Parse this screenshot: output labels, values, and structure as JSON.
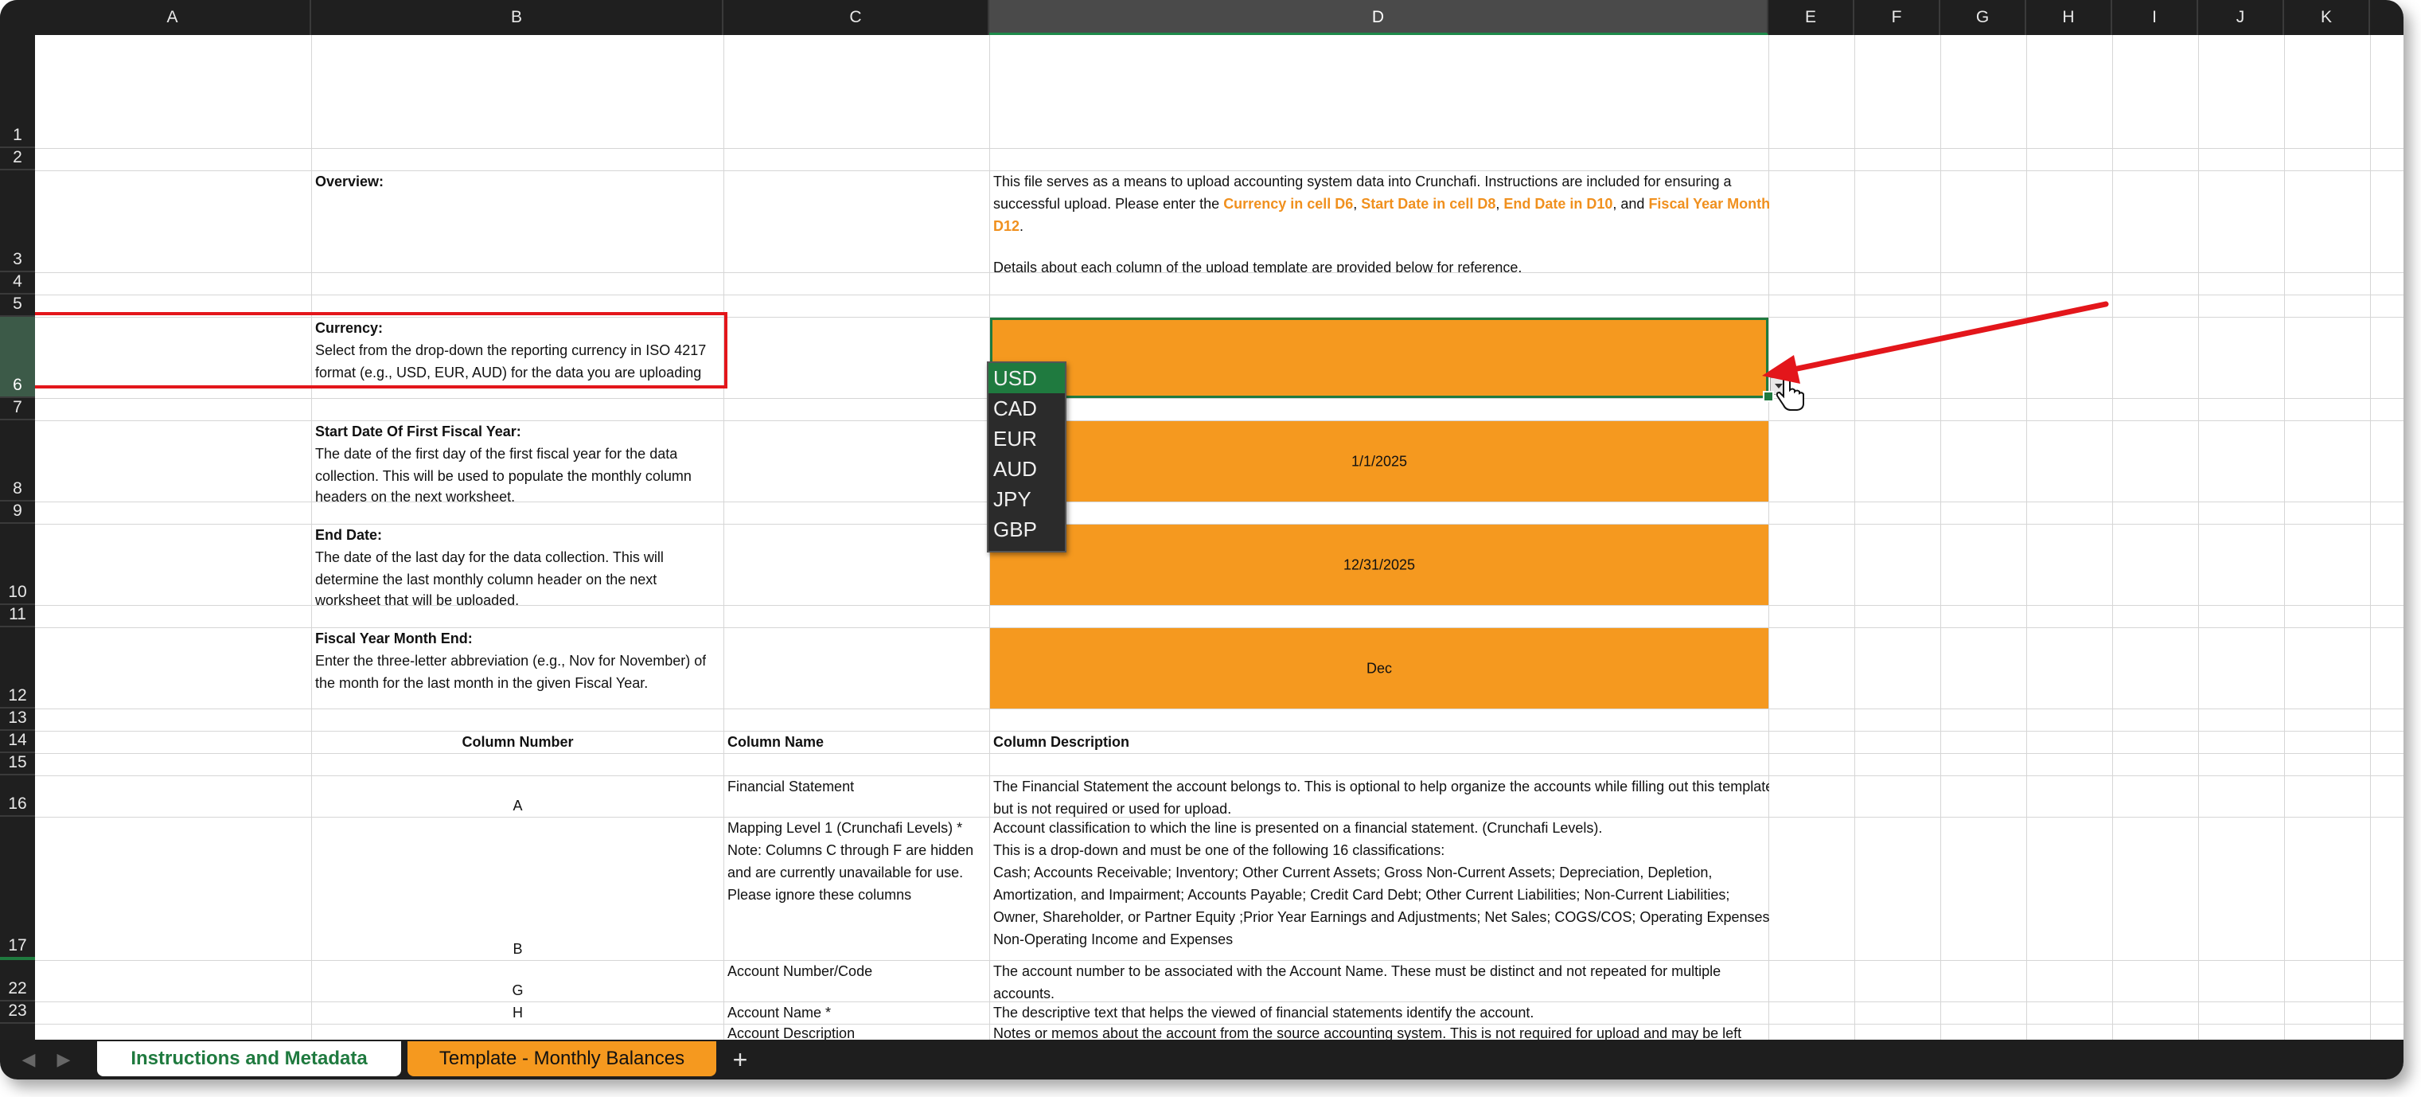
{
  "sheet": {
    "columns": [
      "A",
      "B",
      "C",
      "D",
      "E",
      "F",
      "G",
      "H",
      "I",
      "J",
      "K"
    ],
    "selected_column": "D",
    "rows": [
      "1",
      "2",
      "3",
      "4",
      "5",
      "6",
      "7",
      "8",
      "9",
      "10",
      "11",
      "12",
      "13",
      "14",
      "15",
      "16",
      "17",
      "22",
      "23"
    ],
    "selected_row": "6"
  },
  "cells": {
    "overview_label": "Overview:",
    "overview_line1": "This file serves as a means to upload accounting system data into Crunchafi. Instructions are included for ensuring a",
    "overview_line2_pre": "successful upload.  Please enter the ",
    "overview_currency": "Currency in cell D6",
    "overview_sep1": ", ",
    "overview_start": "Start Date in cell D8",
    "overview_sep2": ", ",
    "overview_end": "End Date in D10",
    "overview_sep3": ", and ",
    "overview_fiscal": "Fiscal Year Month End in",
    "overview_line3": "D12",
    "overview_line3_end": ".",
    "overview_line4": "Details about each column of the upload template are provided below for reference.",
    "currency_label": "Currency:",
    "currency_line1": "Select from the drop-down the reporting currency in ISO 4217",
    "currency_line2": "format (e.g., USD, EUR, AUD) for the data you are uploading",
    "start_label": "Start Date Of First Fiscal Year:",
    "start_line1": "The date of the first day of the first fiscal year for the data",
    "start_line2": "collection. This will be used to populate the monthly column",
    "start_line3": "headers on the next worksheet.",
    "start_value": "1/1/2025",
    "end_label": "End Date:",
    "end_line1": "The date of the last day for the data collection. This will",
    "end_line2": "determine the last monthly column header on the next",
    "end_line3": "worksheet that will be uploaded.",
    "end_value": "12/31/2025",
    "fiscal_label": "Fiscal Year Month End:",
    "fiscal_line1": "Enter the three-letter abbreviation (e.g., Nov for November) of",
    "fiscal_line2": "the month for the last month in the given Fiscal Year.",
    "fiscal_value": "Dec",
    "hdr_col_number": "Column Number",
    "hdr_col_name": "Column Name",
    "hdr_col_desc": "Column Description",
    "r16_num": "A",
    "r16_name": "Financial Statement",
    "r16_desc1": "The Financial Statement the account belongs to. This is optional to help organize the accounts while filling out this template,",
    "r16_desc2": "but is not required or used for upload.",
    "r17_num": "B",
    "r17_name1": "Mapping Level 1 (Crunchafi Levels) *",
    "r17_name2": "Note: Columns C through F are hidden",
    "r17_name3": "and are currently unavailable for use.",
    "r17_name4": "Please ignore these columns",
    "r17_desc1": "Account classification to which the line is presented on a financial statement. (Crunchafi Levels).",
    "r17_desc2": "This is a drop-down and must be one of the following 16 classifications:",
    "r17_desc3": "Cash; Accounts Receivable; Inventory; Other Current Assets; Gross Non-Current Assets; Depreciation, Depletion,",
    "r17_desc4": "Amortization, and Impairment; Accounts Payable; Credit Card Debt; Other Current Liabilities; Non-Current Liabilities;",
    "r17_desc5": "Owner, Shareholder, or Partner Equity ;Prior Year Earnings and Adjustments; Net Sales; COGS/COS; Operating Expenses;",
    "r17_desc6": "Non-Operating Income and Expenses",
    "r22_num": "G",
    "r22_name": "Account Number/Code",
    "r22_desc1": "The account number to be associated with the Account Name. These must be distinct and not repeated for multiple",
    "r22_desc2": "accounts.",
    "r23_num": "H",
    "r23_name": "Account Name *",
    "r23_desc": "The descriptive text that helps the viewed of financial statements identify the account.",
    "r24_name": "Account Description",
    "r24_desc": "Notes or memos about the account from the source accounting system. This is not required for upload and may be left"
  },
  "dropdown": {
    "options": [
      "USD",
      "CAD",
      "EUR",
      "AUD",
      "JPY",
      "GBP"
    ],
    "highlighted": "USD"
  },
  "tabs": {
    "tab1": "Instructions and Metadata",
    "tab2": "Template - Monthly Balances",
    "add": "+",
    "prev": "◀",
    "next": "▶"
  },
  "colors": {
    "accent_green": "#1f7a3f",
    "orange_fill": "#f5991f",
    "orange_text": "#f0901e",
    "highlight_red": "#e3161b"
  }
}
